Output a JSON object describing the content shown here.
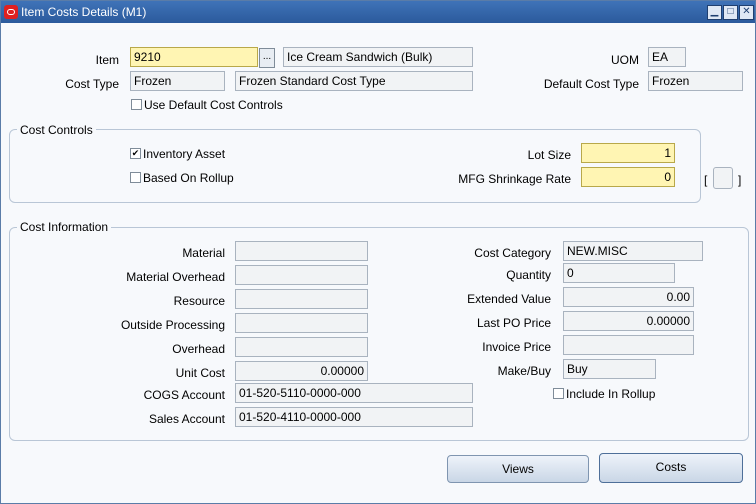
{
  "window": {
    "title": "Item Costs Details (M1)",
    "minimize": "▁",
    "maximize": "□",
    "close": "✕"
  },
  "header": {
    "item_label": "Item",
    "item_value": "9210",
    "item_desc": "Ice Cream Sandwich (Bulk)",
    "lov": "...",
    "uom_label": "UOM",
    "uom_value": "EA",
    "cost_type_label": "Cost Type",
    "cost_type_value": "Frozen",
    "cost_type_desc": "Frozen Standard Cost Type",
    "default_cost_type_label": "Default Cost Type",
    "default_cost_type_value": "Frozen",
    "use_default_label": "Use Default Cost Controls"
  },
  "cost_controls": {
    "title": "Cost Controls",
    "inventory_asset_label": "Inventory Asset",
    "inventory_asset_checked": "✔",
    "based_on_rollup_label": "Based On Rollup",
    "lot_size_label": "Lot Size",
    "lot_size_value": "1",
    "shrinkage_label": "MFG Shrinkage Rate",
    "shrinkage_value": "0",
    "bracket_left": "[",
    "bracket_right": "]"
  },
  "cost_information": {
    "title": "Cost Information",
    "material_label": "Material",
    "material_value": "",
    "material_overhead_label": "Material Overhead",
    "material_overhead_value": "",
    "resource_label": "Resource",
    "resource_value": "",
    "outside_processing_label": "Outside Processing",
    "outside_processing_value": "",
    "overhead_label": "Overhead",
    "overhead_value": "",
    "unit_cost_label": "Unit Cost",
    "unit_cost_value": "0.00000",
    "cogs_label": "COGS Account",
    "cogs_value": "01-520-5110-0000-000",
    "sales_label": "Sales Account",
    "sales_value": "01-520-4110-0000-000",
    "cost_category_label": "Cost Category",
    "cost_category_value": "NEW.MISC",
    "quantity_label": "Quantity",
    "quantity_value": "0",
    "extended_value_label": "Extended Value",
    "extended_value_value": "0.00",
    "last_po_label": "Last PO Price",
    "last_po_value": "0.00000",
    "invoice_price_label": "Invoice Price",
    "invoice_price_value": "",
    "make_buy_label": "Make/Buy",
    "make_buy_value": "Buy",
    "include_rollup_label": "Include In Rollup"
  },
  "buttons": {
    "views": "Views",
    "costs": "Costs"
  }
}
